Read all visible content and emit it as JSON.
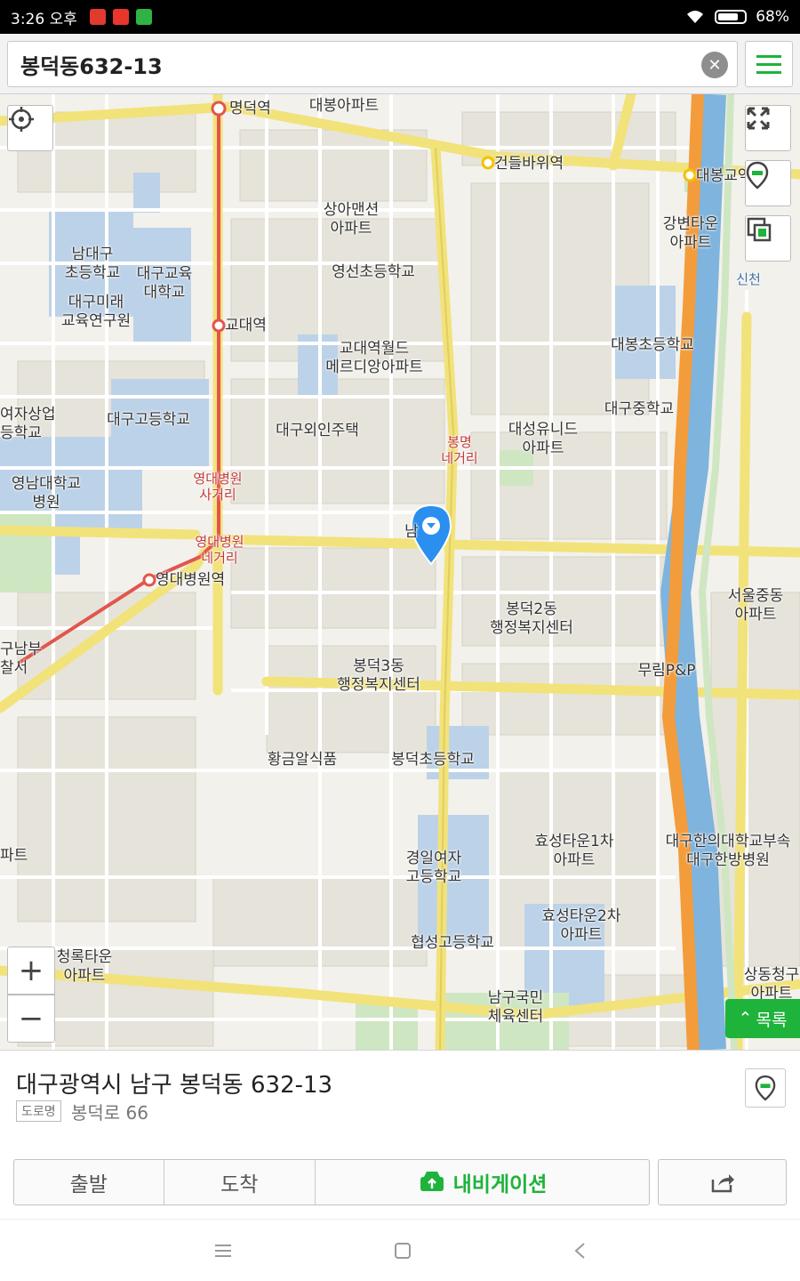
{
  "status_bar": {
    "time": "3:26 오후",
    "battery": "68%",
    "icons": [
      "notification-app-icon",
      "notification-app-icon",
      "notification-app-icon",
      "wifi-icon",
      "battery-icon"
    ]
  },
  "search": {
    "query": "봉덕동632-13",
    "clear_icon": "close-icon",
    "menu_icon": "hamburger-menu-icon"
  },
  "map": {
    "controls": {
      "locate_icon": "crosshair-icon",
      "fullscreen_icon": "expand-icon",
      "place_icon": "map-pin-icon",
      "layers_icon": "layers-icon",
      "zoom_in": "+",
      "zoom_out": "−"
    },
    "list_button": {
      "label": "목록",
      "icon": "chevron-up-icon"
    },
    "labels": {
      "myeongdeok_station": "명덕역",
      "daebong_apt": "대봉아파트",
      "geondeulbawi_station": "건들바위역",
      "daebonggyo": "대봉교역",
      "sanga_mansion": "상아맨션\n아파트",
      "gangbyeon_town": "강변타운\n아파트",
      "namdaegu_elem": "남대구\n초등학교",
      "daegu_edu_univ": "대구교육\n대학교",
      "yeongseon_elem": "영선초등학교",
      "daegu_mirae": "대구미래\n교육연구원",
      "gyodae_station": "교대역",
      "gyodae_world": "교대역월드\n메르디앙아파트",
      "daebong_elem": "대봉초등학교",
      "girls_commercial": "여자상업\n등학교",
      "daegu_high": "대구고등학교",
      "foreign_house": "대구외인주택",
      "daeseong_unid": "대성유니드\n아파트",
      "daegu_middle": "대구중학교",
      "bongmyeong_cross": "봉명\n네거리",
      "yeungnam_hospital": "영남대학교\n병원",
      "ydh_4way": "영대병원\n사거리",
      "ydh_crossroad": "영대병원\n네거리",
      "ydh_station": "영대병원역",
      "seoul_middle": "서울중동\n아파트",
      "bongdeok2": "봉덕2동\n행정복지센터",
      "nambu_police": "구남부\n찰서",
      "murim": "무림P&P",
      "bongdeok3": "봉덕3동\n행정복지센터",
      "hwanggeum": "황금알식품",
      "bongdeok_elem": "봉덕초등학교",
      "hyoseong1": "효성타운1차\n아파트",
      "oriental_hospital": "대구한의대학교부속\n대구한방병원",
      "gyeongil_girls": "경일여자\n고등학교",
      "hyoseong2": "효성타운2차\n아파트",
      "cheongrok": "청록타운\n아파트",
      "hyeopseong_high": "협성고등학교",
      "namgu_sports": "남구국민\n체육센터",
      "sangdong": "상동청구\n아파트",
      "sincheon": "신천",
      "apt_left": "파트",
      "pin_partial": "남"
    }
  },
  "place": {
    "address": "대구광역시 남구 봉덕동 632-13",
    "road_badge": "도로명",
    "road_address": "봉덕로 66",
    "pin_icon": "map-pin-icon"
  },
  "actions": {
    "start": "출발",
    "arrive": "도착",
    "navigation": "내비게이션",
    "navigation_icon": "car-navigation-icon",
    "share_icon": "share-icon"
  },
  "navbar": {
    "menu_icon": "menu-icon",
    "home_icon": "home-square-icon",
    "back_icon": "back-chevron-icon"
  },
  "colors": {
    "accent": "#1eb33b",
    "river": "#7eb4dd",
    "arterial": "#f2e27a",
    "expressway": "#f39c3c",
    "subway": "#e2554d"
  }
}
